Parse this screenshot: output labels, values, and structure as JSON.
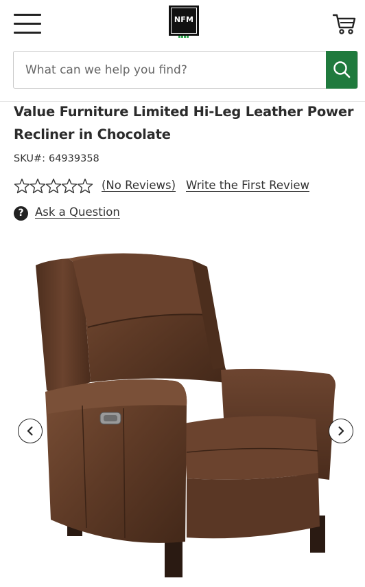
{
  "header": {
    "menu_icon": "hamburger-menu-icon",
    "logo_text": "NFM",
    "cart_icon": "shopping-cart-icon",
    "brand_color": "#1f7a3d"
  },
  "search": {
    "placeholder": "What can we help you find?",
    "value": "",
    "button_icon": "search-icon"
  },
  "product": {
    "title": "Value Furniture Limited Hi-Leg Leather Power Recliner in Chocolate",
    "sku_label": "SKU#:",
    "sku_value": "64939358",
    "rating": {
      "stars_filled": 0,
      "stars_total": 5,
      "reviews_link": "(No Reviews)",
      "write_review_link": "Write the First Review"
    },
    "ask_question_link": "Ask a Question",
    "ask_icon": "question-circle-icon",
    "image_alt": "Chocolate leather power recliner"
  },
  "carousel": {
    "prev_icon": "chevron-left-icon",
    "next_icon": "chevron-right-icon"
  }
}
